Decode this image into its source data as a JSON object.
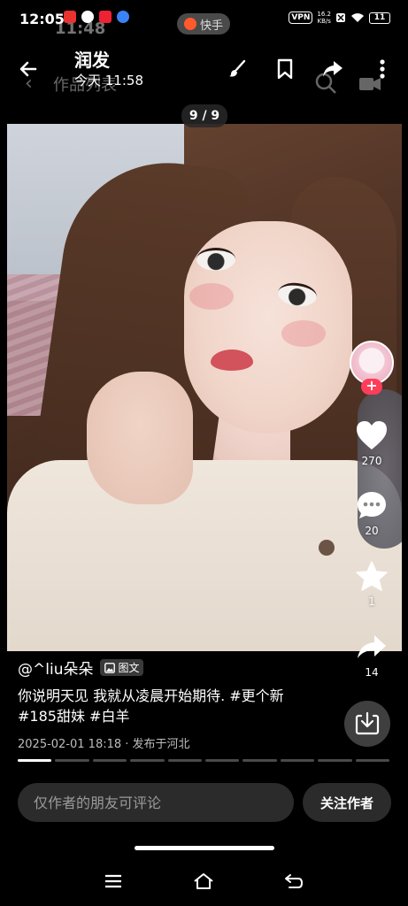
{
  "status_bar": {
    "time": "12:05",
    "ghost_time": "11:48",
    "vpn": "VPN",
    "net_speed_value": "16.2",
    "net_speed_unit": "KB/s",
    "battery": "11"
  },
  "kuaishou_pill": {
    "label": "快手"
  },
  "nav": {
    "title": "润发",
    "subtitle": "今天 11:58",
    "ghost_list_label": "作品列表"
  },
  "photo": {
    "page_indicator": "9 / 9"
  },
  "rail": {
    "follow_plus": "+",
    "likes": "270",
    "comments": "20",
    "favorites": "1",
    "shares": "14"
  },
  "post": {
    "author": "@^liu朵朵",
    "type_badge": "图文",
    "caption_line1": "你说明天见 我就从凌晨开始期待. #更个新",
    "caption_line2": "#185甜妹 #白羊",
    "meta": "2025-02-01 18:18 · 发布于河北"
  },
  "progress": {
    "total": 10,
    "current": 1
  },
  "bottom": {
    "comment_placeholder": "仅作者的朋友可评论",
    "follow_label": "关注作者"
  },
  "colors": {
    "background": "#000000",
    "accent_pink": "#ff3d5a",
    "input_bg": "#2b2b2b"
  }
}
